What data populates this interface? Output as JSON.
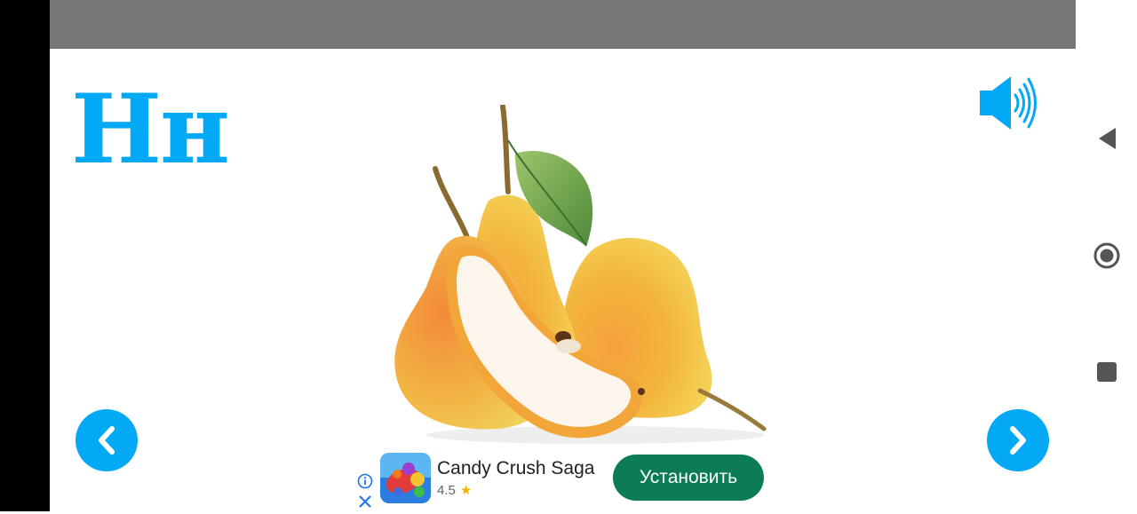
{
  "lesson": {
    "letter": "Нн",
    "accent_color": "#03A9F4"
  },
  "picture": {
    "subject": "pears-image"
  },
  "controls": {
    "sound_icon": "speaker-icon",
    "prev_icon": "chevron-left-icon",
    "next_icon": "chevron-right-icon"
  },
  "ad": {
    "app_name": "Candy Crush Saga",
    "rating": "4.5",
    "install_label": "Установить",
    "install_color": "#0B7C57"
  },
  "system": {
    "status_bar_color": "#777777",
    "nav_buttons": [
      "back-icon",
      "home-icon",
      "recents-icon"
    ]
  }
}
